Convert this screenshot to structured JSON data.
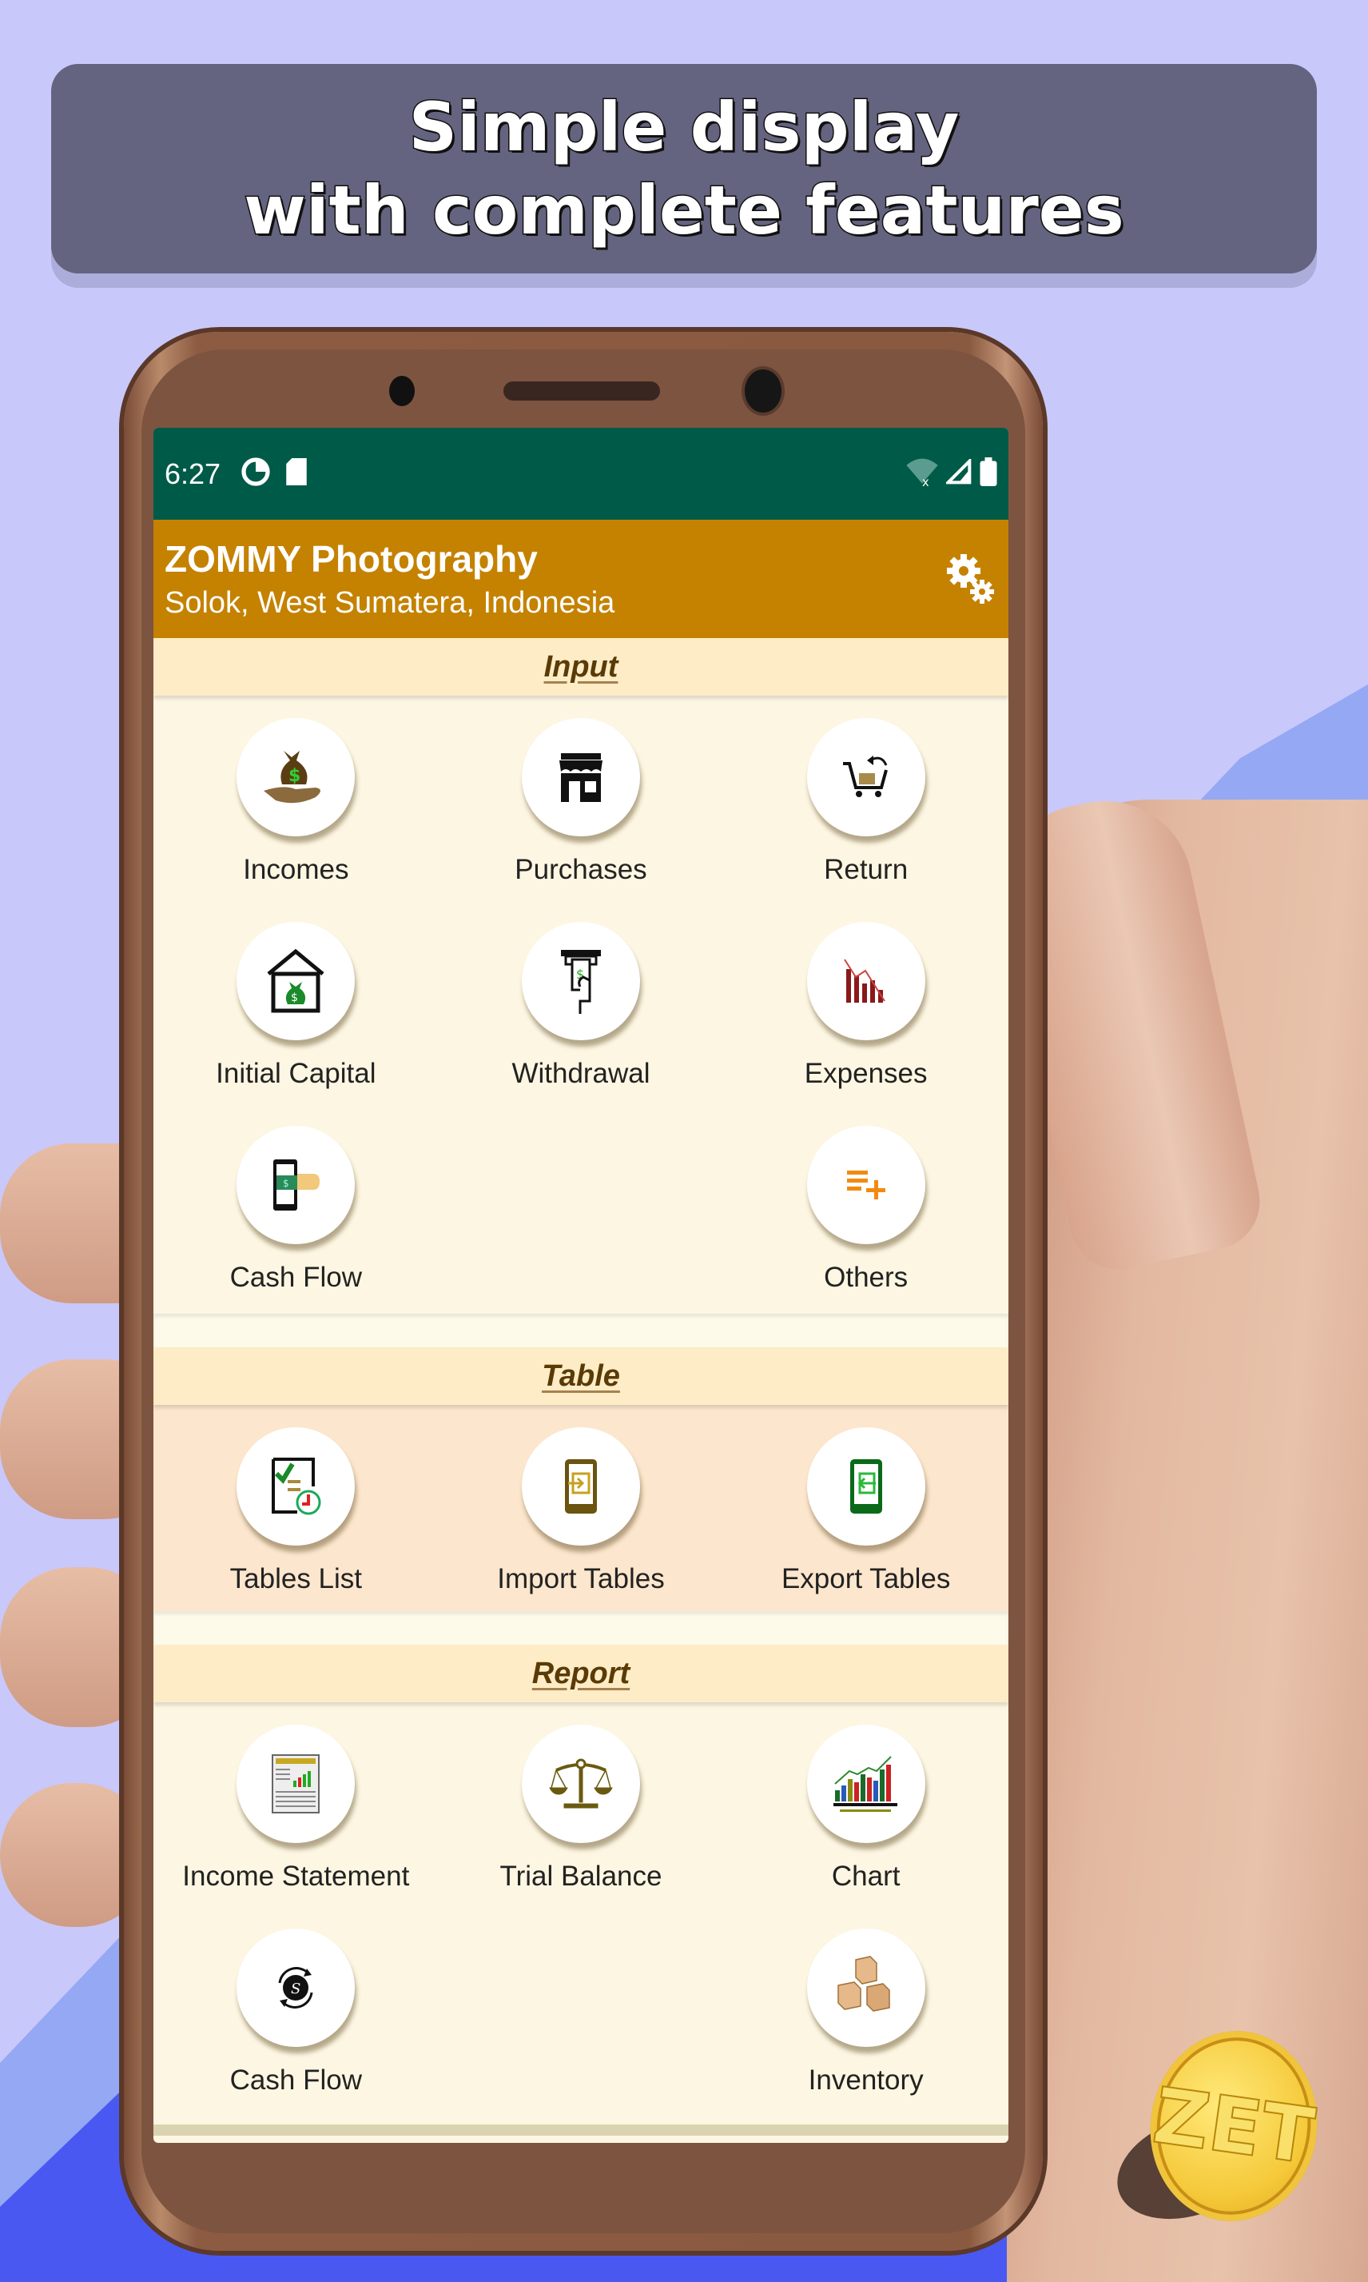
{
  "banner": {
    "line1": "Simple display",
    "line2": "with complete features"
  },
  "status_bar": {
    "time": "6:27",
    "left_icons": [
      "data-saver-icon",
      "sd-card-icon"
    ],
    "right_icons": [
      "wifi-off-icon",
      "signal-icon",
      "battery-icon"
    ]
  },
  "app_bar": {
    "title": "ZOMMY Photography",
    "subtitle": "Solok, West Sumatera, Indonesia",
    "settings_icon": "gears-icon"
  },
  "sections": {
    "input": {
      "title": "Input",
      "items": [
        {
          "label": "Incomes",
          "icon": "money-bag-hand-icon"
        },
        {
          "label": "Purchases",
          "icon": "store-icon"
        },
        {
          "label": "Return",
          "icon": "cart-return-icon"
        },
        {
          "label": "Initial Capital",
          "icon": "house-money-icon"
        },
        {
          "label": "Withdrawal",
          "icon": "atm-withdrawal-icon"
        },
        {
          "label": "Expenses",
          "icon": "declining-chart-icon"
        },
        {
          "label": "Cash Flow",
          "icon": "phone-cash-icon"
        },
        {
          "label": "",
          "icon": ""
        },
        {
          "label": "Others",
          "icon": "list-add-icon"
        }
      ]
    },
    "table": {
      "title": "Table",
      "items": [
        {
          "label": "Tables List",
          "icon": "checklist-clock-icon"
        },
        {
          "label": "Import Tables",
          "icon": "phone-import-icon"
        },
        {
          "label": "Export Tables",
          "icon": "phone-export-icon"
        }
      ]
    },
    "report": {
      "title": "Report",
      "items": [
        {
          "label": "Income Statement",
          "icon": "report-document-icon"
        },
        {
          "label": "Trial Balance",
          "icon": "balance-scale-icon"
        },
        {
          "label": "Chart",
          "icon": "bar-chart-icon"
        },
        {
          "label": "Cash Flow",
          "icon": "dollar-cycle-icon"
        },
        {
          "label": "",
          "icon": ""
        },
        {
          "label": "Inventory",
          "icon": "boxes-icon"
        }
      ]
    }
  },
  "colors": {
    "status_bar": "#005a48",
    "app_bar": "#c48200",
    "section_header": "#fdecc6",
    "banner": "#646480",
    "background": "#c8c8fa"
  },
  "logo": {
    "text": "ZET",
    "icon": "coin-logo-icon"
  }
}
